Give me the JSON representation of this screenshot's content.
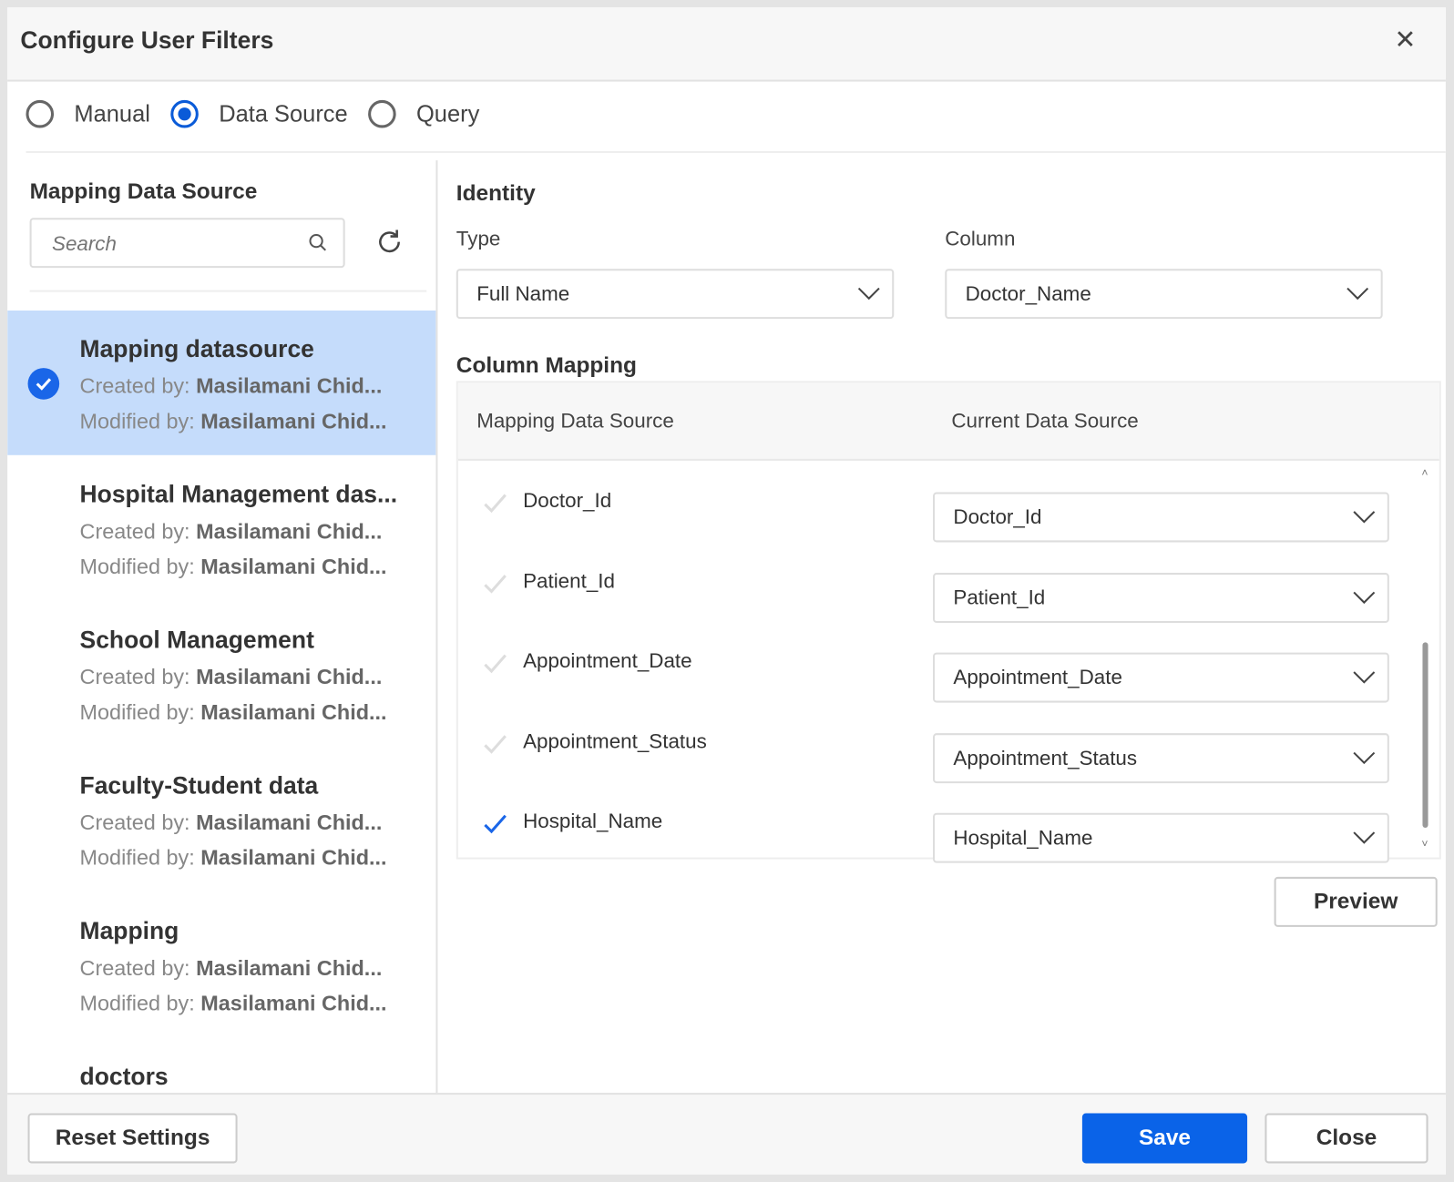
{
  "dialog": {
    "title": "Configure User Filters"
  },
  "modes": [
    {
      "label": "Manual",
      "selected": false
    },
    {
      "label": "Data Source",
      "selected": true
    },
    {
      "label": "Query",
      "selected": false
    }
  ],
  "left": {
    "heading": "Mapping Data Source",
    "search_placeholder": "Search",
    "items": [
      {
        "name": "Mapping datasource",
        "created_label": "Created by:",
        "created": "Masilamani Chid...",
        "modified_label": "Modified by:",
        "modified": "Masilamani Chid...",
        "selected": true
      },
      {
        "name": "Hospital Management das...",
        "created_label": "Created by:",
        "created": "Masilamani Chid...",
        "modified_label": "Modified by:",
        "modified": "Masilamani Chid..."
      },
      {
        "name": "School Management",
        "created_label": "Created by:",
        "created": "Masilamani Chid...",
        "modified_label": "Modified by:",
        "modified": "Masilamani Chid..."
      },
      {
        "name": "Faculty-Student data",
        "created_label": "Created by:",
        "created": "Masilamani Chid...",
        "modified_label": "Modified by:",
        "modified": "Masilamani Chid..."
      },
      {
        "name": "Mapping",
        "created_label": "Created by:",
        "created": "Masilamani Chid...",
        "modified_label": "Modified by:",
        "modified": "Masilamani Chid..."
      },
      {
        "name": "doctors"
      }
    ]
  },
  "identity": {
    "heading": "Identity",
    "type_label": "Type",
    "type_value": "Full Name",
    "column_label": "Column",
    "column_value": "Doctor_Name"
  },
  "mapping": {
    "heading": "Column Mapping",
    "col1": "Mapping Data Source",
    "col2": "Current Data Source",
    "rows": [
      {
        "name": "Doctor_Id",
        "value": "Doctor_Id",
        "checked": false
      },
      {
        "name": "Patient_Id",
        "value": "Patient_Id",
        "checked": false
      },
      {
        "name": "Appointment_Date",
        "value": "Appointment_Date",
        "checked": false
      },
      {
        "name": "Appointment_Status",
        "value": "Appointment_Status",
        "checked": false
      },
      {
        "name": "Hospital_Name",
        "value": "Hospital_Name",
        "checked": true
      }
    ]
  },
  "buttons": {
    "preview": "Preview",
    "reset": "Reset Settings",
    "save": "Save",
    "close": "Close"
  },
  "colors": {
    "accent": "#0a63e8",
    "selected_bg": "#c5dcfb"
  }
}
